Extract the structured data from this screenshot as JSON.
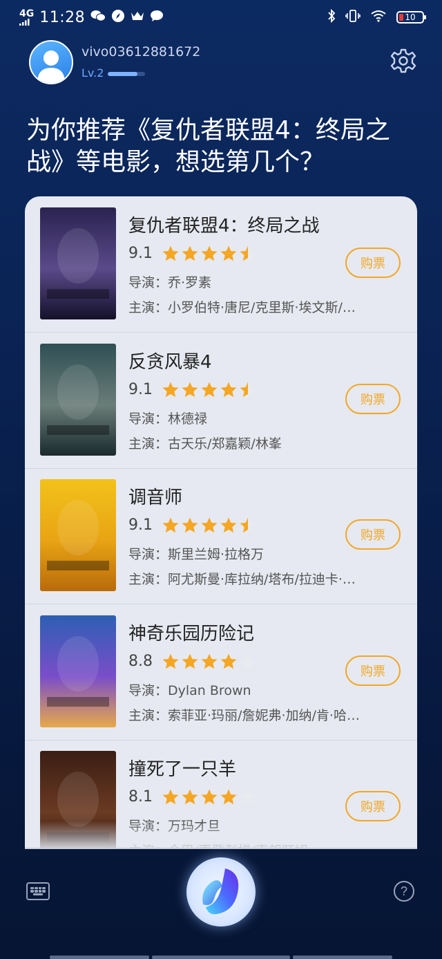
{
  "status_bar": {
    "network": "4G",
    "time": "11:28",
    "battery": "10",
    "battery_level": 0.1
  },
  "user": {
    "name": "vivo03612881672",
    "level": "Lv.2",
    "level_progress": 0.8
  },
  "prompt": "为你推荐《复仇者联盟4：终局之战》等电影，想选第几个？",
  "labels": {
    "director": "导演：",
    "cast": "主演：",
    "buy": "购票"
  },
  "movies": [
    {
      "title": "复仇者联盟4：终局之战",
      "rating": "9.1",
      "stars": 4.5,
      "director": "乔·罗素",
      "cast": "小罗伯特·唐尼/克里斯·埃文斯/…",
      "poster_colors": [
        "#2a2350",
        "#5a4a8a",
        "#14112a"
      ]
    },
    {
      "title": "反贪风暴4",
      "rating": "9.1",
      "stars": 4.5,
      "director": "林德禄",
      "cast": "古天乐/郑嘉颖/林峯",
      "poster_colors": [
        "#2f4f55",
        "#6a7d78",
        "#1a2a2e"
      ]
    },
    {
      "title": "调音师",
      "rating": "9.1",
      "stars": 4.5,
      "director": "斯里兰姆·拉格万",
      "cast": "阿尤斯曼·库拉纳/塔布/拉迪卡·…",
      "poster_colors": [
        "#f2c21a",
        "#e8a414",
        "#b86a0a"
      ]
    },
    {
      "title": "神奇乐园历险记",
      "rating": "8.8",
      "stars": 4,
      "director": "Dylan Brown",
      "cast": "索菲亚·玛丽/詹妮弗·加纳/肯·哈…",
      "poster_colors": [
        "#2d5fb3",
        "#7a4ec9",
        "#e7a94a"
      ]
    },
    {
      "title": "撞死了一只羊",
      "rating": "8.1",
      "stars": 4,
      "director": "万玛才旦",
      "cast": "金巴/更登彭措/索朗旺姆",
      "poster_colors": [
        "#3a1e14",
        "#6b3a22",
        "#1a0f0a"
      ]
    }
  ],
  "colors": {
    "accent": "#f2a623",
    "star": "#f5a623",
    "background": "#0a2354",
    "card": "#e6e9f1"
  },
  "icons": {
    "settings": "gear-icon",
    "keyboard": "keyboard-icon",
    "help": "help-icon",
    "assistant": "voice-assistant-icon"
  }
}
